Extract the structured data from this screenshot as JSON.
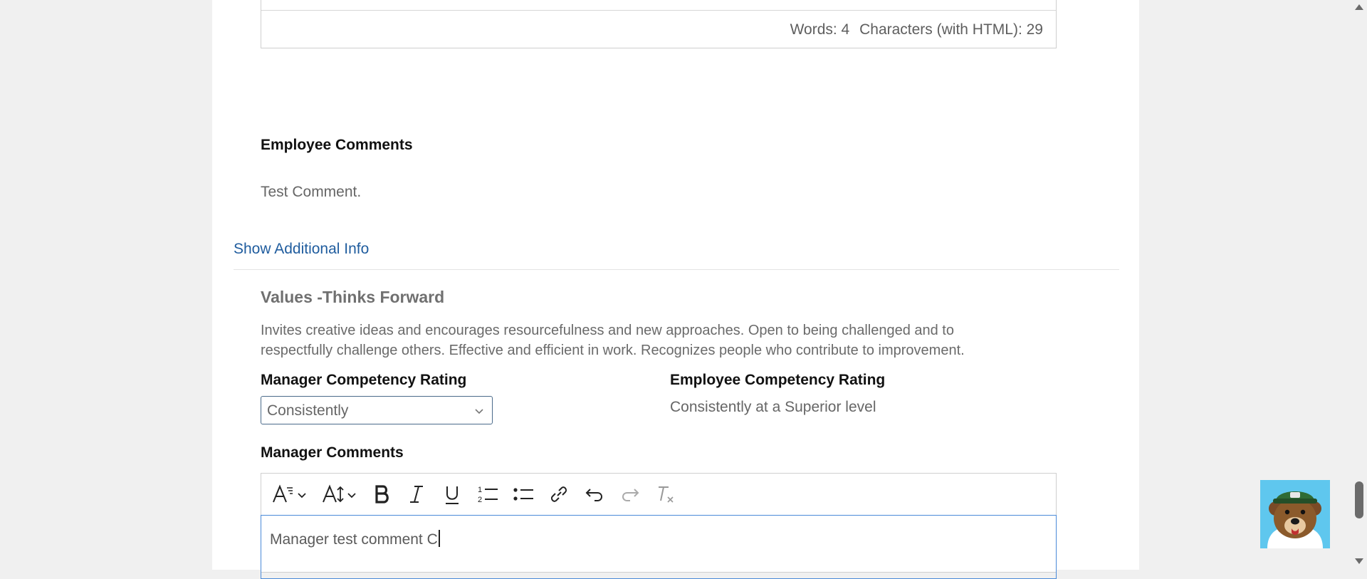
{
  "previous_editor": {
    "words_label": "Words: 4",
    "characters_label": "Characters (with HTML): 29"
  },
  "employee_comments": {
    "label": "Employee Comments",
    "value": "Test Comment."
  },
  "show_additional_info": "Show Additional Info",
  "competency": {
    "title": "Values -Thinks Forward",
    "description": "Invites creative ideas and encourages resourcefulness and new approaches. Open to being challenged and to respectfully challenge others. Effective and efficient in work. Recognizes people who contribute to improvement.",
    "manager_rating_label": "Manager Competency Rating",
    "manager_rating_value": "Consistently",
    "employee_rating_label": "Employee Competency Rating",
    "employee_rating_value": "Consistently at a Superior level"
  },
  "manager_comments": {
    "label": "Manager Comments",
    "value": "Manager test comment C"
  },
  "toolbar": {
    "items": [
      "font-family-icon",
      "font-size-icon",
      "bold-icon",
      "italic-icon",
      "underline-icon",
      "ordered-list-icon",
      "unordered-list-icon",
      "link-icon",
      "undo-icon",
      "redo-icon",
      "clear-formatting-icon"
    ]
  },
  "colors": {
    "link": "#1f5c9e",
    "focus_border": "#4a8ad8",
    "mascot_background": "#5fc7ee"
  }
}
